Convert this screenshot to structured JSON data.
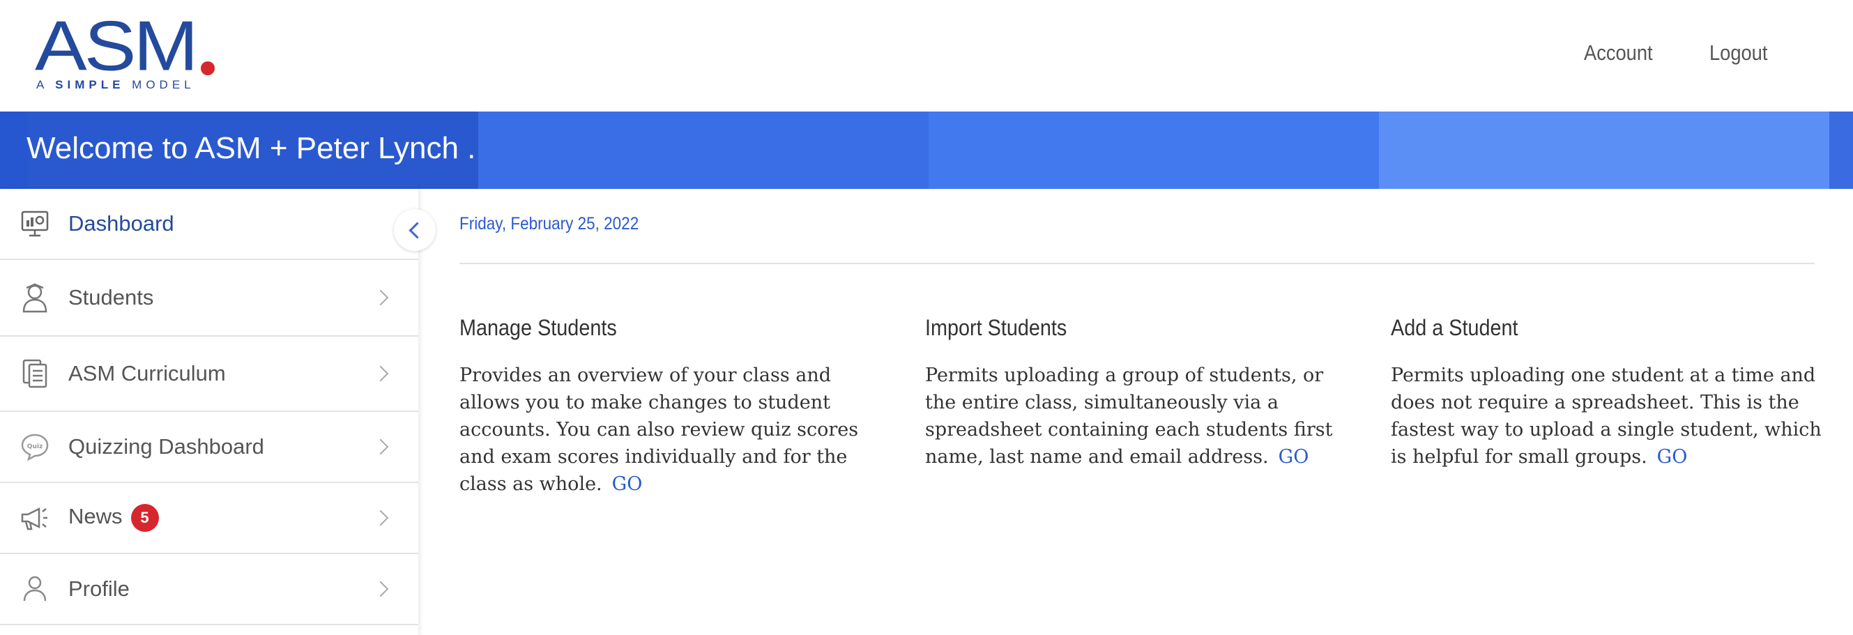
{
  "header": {
    "logo_main": "ASM",
    "logo_sub_prefix": "A",
    "logo_sub_bold": "SIMPLE",
    "logo_sub_suffix": "MODEL",
    "account_label": "Account",
    "logout_label": "Logout",
    "brand_color": "#234a9c",
    "accent_red": "#d7262e"
  },
  "banner": {
    "welcome_text": "Welcome to ASM + Peter Lynch ."
  },
  "sidebar": {
    "items": [
      {
        "label": "Dashboard",
        "icon": "dashboard-monitor-icon",
        "active": true
      },
      {
        "label": "Students",
        "icon": "student-icon"
      },
      {
        "label": "ASM Curriculum",
        "icon": "documents-icon"
      },
      {
        "label": "Quizzing Dashboard",
        "icon": "quiz-bubble-icon"
      },
      {
        "label": "News",
        "icon": "megaphone-icon",
        "badge": "5"
      },
      {
        "label": "Profile",
        "icon": "user-icon"
      }
    ]
  },
  "main": {
    "date": "Friday, February 25, 2022",
    "cards": [
      {
        "title": "Manage Students",
        "body": "Provides an overview of your class and allows you to make changes to student accounts. You can also review quiz scores and exam scores individually and for the class as whole.",
        "link": "GO"
      },
      {
        "title": "Import Students",
        "body": "Permits uploading a group of students, or the entire class, simultaneously via a spreadsheet containing each students first name, last name and email address.",
        "link": "GO"
      },
      {
        "title": "Add a Student",
        "body": "Permits uploading one student at a time and does not require a spreadsheet. This is the fastest way to upload a single student, which is helpful for small groups.",
        "link": "GO"
      }
    ]
  }
}
